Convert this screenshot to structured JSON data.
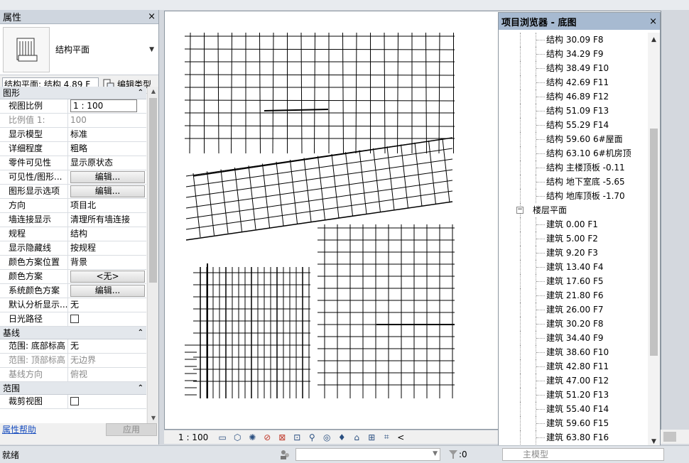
{
  "properties": {
    "title": "属性",
    "close": "×",
    "type_name": "结构平面",
    "filter_value": "结构平面: 结构 4.89 F",
    "edit_type_label": "编辑类型",
    "sections": [
      {
        "name": "图形",
        "rows": [
          {
            "name": "视图比例",
            "value": "1 : 100",
            "kind": "box"
          },
          {
            "name": "比例值 1:",
            "value": "100",
            "kind": "text",
            "dim": true
          },
          {
            "name": "显示模型",
            "value": "标准",
            "kind": "text"
          },
          {
            "name": "详细程度",
            "value": "粗略",
            "kind": "text"
          },
          {
            "name": "零件可见性",
            "value": "显示原状态",
            "kind": "text"
          },
          {
            "name": "可见性/图形...",
            "value": "编辑...",
            "kind": "button"
          },
          {
            "name": "图形显示选项",
            "value": "编辑...",
            "kind": "button"
          },
          {
            "name": "方向",
            "value": "项目北",
            "kind": "text"
          },
          {
            "name": "墙连接显示",
            "value": "清理所有墙连接",
            "kind": "text"
          },
          {
            "name": "规程",
            "value": "结构",
            "kind": "text"
          },
          {
            "name": "显示隐藏线",
            "value": "按规程",
            "kind": "text"
          },
          {
            "name": "颜色方案位置",
            "value": "背景",
            "kind": "text"
          },
          {
            "name": "颜色方案",
            "value": "<无>",
            "kind": "button"
          },
          {
            "name": "系统颜色方案",
            "value": "编辑...",
            "kind": "button"
          },
          {
            "name": "默认分析显示...",
            "value": "无",
            "kind": "text"
          },
          {
            "name": "日光路径",
            "value": "",
            "kind": "checkbox"
          }
        ]
      },
      {
        "name": "基线",
        "rows": [
          {
            "name": "范围: 底部标高",
            "value": "无",
            "kind": "text"
          },
          {
            "name": "范围: 顶部标高",
            "value": "无边界",
            "kind": "text",
            "dim": true
          },
          {
            "name": "基线方向",
            "value": "俯视",
            "kind": "text",
            "dim": true
          }
        ]
      },
      {
        "name": "范围",
        "rows": [
          {
            "name": "裁剪视图",
            "value": "",
            "kind": "checkbox"
          }
        ]
      }
    ],
    "help_link": "属性帮助",
    "apply_label": "应用"
  },
  "view_bar": {
    "scale": "1 : 100",
    "icons": [
      "detail-level-icon",
      "visual-style-icon",
      "sun-path-icon",
      "shadows-icon",
      "crop-view-icon",
      "show-crop-icon",
      "temporary-hide-icon",
      "reveal-hidden-icon",
      "analytical-model-icon",
      "constraints-icon",
      "highlight-icon",
      "thin-lines-icon"
    ],
    "nav_arrow": "<"
  },
  "browser": {
    "title": "项目浏览器 - 底图",
    "close": "×",
    "structural_items": [
      "结构 30.09 F8",
      "结构 34.29 F9",
      "结构 38.49 F10",
      "结构 42.69 F11",
      "结构 46.89 F12",
      "结构 51.09 F13",
      "结构 55.29 F14",
      "结构 59.60 6#屋面",
      "结构 63.10 6#机房顶",
      "结构 主楼顶板 -0.11",
      "结构 地下室底 -5.65",
      "结构 地库顶板 -1.70"
    ],
    "group_label": "楼层平面",
    "group_toggle": "−",
    "floor_items": [
      "建筑 0.00 F1",
      "建筑 5.00 F2",
      "建筑 9.20 F3",
      "建筑 13.40 F4",
      "建筑 17.60 F5",
      "建筑 21.80 F6",
      "建筑 26.00 F7",
      "建筑 30.20 F8",
      "建筑 34.40 F9",
      "建筑 38.60 F10",
      "建筑 42.80 F11",
      "建筑 47.00 F12",
      "建筑 51.20 F13",
      "建筑 55.40 F14",
      "建筑 59.60 F15",
      "建筑 63.80 F16"
    ]
  },
  "status": {
    "ready": "就绪",
    "filter_count": ":0",
    "main_model": "主模型"
  }
}
